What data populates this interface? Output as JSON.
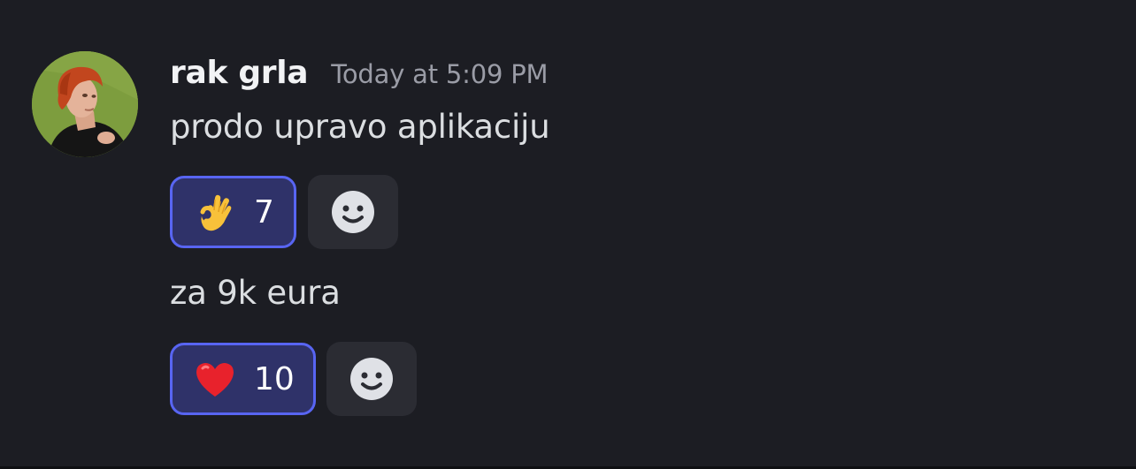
{
  "message": {
    "author": {
      "username": "rak grla",
      "avatar_icon": "user-avatar-portrait"
    },
    "timestamp": "Today at 5:09 PM",
    "lines": [
      {
        "text": "prodo upravo aplikaciju",
        "reaction": {
          "emoji_icon": "ok-hand-emoji",
          "count": "7",
          "active": true
        },
        "add_reaction_icon": "smiley-face-icon"
      },
      {
        "text": "za 9k eura",
        "reaction": {
          "emoji_icon": "red-heart-emoji",
          "count": "10",
          "active": true
        },
        "add_reaction_icon": "smiley-face-icon"
      }
    ]
  },
  "colors": {
    "background": "#1c1d23",
    "reaction_active_bg": "#2f3269",
    "reaction_active_border": "#5865f2",
    "add_reaction_bg": "#2b2c33",
    "username": "#f2f3f5",
    "timestamp": "#9a9ca6",
    "message_text": "#dbdee1"
  }
}
